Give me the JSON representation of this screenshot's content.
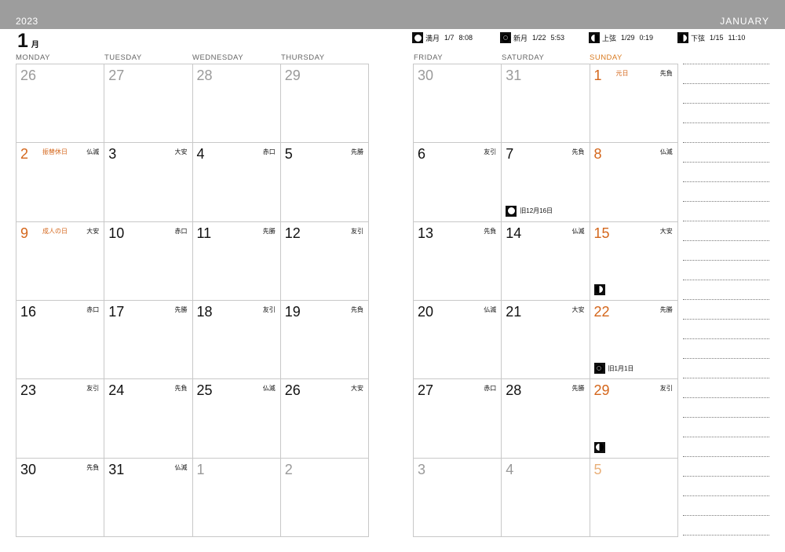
{
  "header": {
    "year": "2023",
    "month_name": "JANUARY",
    "month_number": "1",
    "month_kanji": "月"
  },
  "moon_phases": [
    {
      "icon": "full-moon-icon",
      "label": "満月",
      "date": "1/7",
      "time": "8:08"
    },
    {
      "icon": "new-moon-icon",
      "label": "新月",
      "date": "1/22",
      "time": "5:53"
    },
    {
      "icon": "first-quarter-moon-icon",
      "label": "上弦",
      "date": "1/29",
      "time": "0:19"
    },
    {
      "icon": "last-quarter-moon-icon",
      "label": "下弦",
      "date": "1/15",
      "time": "11:10"
    }
  ],
  "weekdays_left": [
    "MONDAY",
    "TUESDAY",
    "WEDNESDAY",
    "THURSDAY"
  ],
  "weekdays_right": [
    "FRIDAY",
    "SATURDAY",
    "SUNDAY"
  ],
  "weeks": [
    [
      {
        "day": "26",
        "other": true
      },
      {
        "day": "27",
        "other": true
      },
      {
        "day": "28",
        "other": true
      },
      {
        "day": "29",
        "other": true
      },
      {
        "day": "30",
        "other": true
      },
      {
        "day": "31",
        "other": true
      },
      {
        "day": "1",
        "holiday": "元日",
        "rokuyo": "先負"
      }
    ],
    [
      {
        "day": "2",
        "holiday": "振替休日",
        "rokuyo": "仏滅"
      },
      {
        "day": "3",
        "rokuyo": "大安"
      },
      {
        "day": "4",
        "rokuyo": "赤口"
      },
      {
        "day": "5",
        "rokuyo": "先勝"
      },
      {
        "day": "6",
        "rokuyo": "友引"
      },
      {
        "day": "7",
        "rokuyo": "先負",
        "moon": "full",
        "note": "旧12月16日"
      },
      {
        "day": "8",
        "rokuyo": "仏滅"
      }
    ],
    [
      {
        "day": "9",
        "holiday": "成人の日",
        "rokuyo": "大安"
      },
      {
        "day": "10",
        "rokuyo": "赤口"
      },
      {
        "day": "11",
        "rokuyo": "先勝"
      },
      {
        "day": "12",
        "rokuyo": "友引"
      },
      {
        "day": "13",
        "rokuyo": "先負"
      },
      {
        "day": "14",
        "rokuyo": "仏滅"
      },
      {
        "day": "15",
        "rokuyo": "大安",
        "moon": "lq"
      }
    ],
    [
      {
        "day": "16",
        "rokuyo": "赤口"
      },
      {
        "day": "17",
        "rokuyo": "先勝"
      },
      {
        "day": "18",
        "rokuyo": "友引"
      },
      {
        "day": "19",
        "rokuyo": "先負"
      },
      {
        "day": "20",
        "rokuyo": "仏滅"
      },
      {
        "day": "21",
        "rokuyo": "大安"
      },
      {
        "day": "22",
        "rokuyo": "先勝",
        "moon": "new",
        "note": "旧1月1日"
      }
    ],
    [
      {
        "day": "23",
        "rokuyo": "友引"
      },
      {
        "day": "24",
        "rokuyo": "先負"
      },
      {
        "day": "25",
        "rokuyo": "仏滅"
      },
      {
        "day": "26",
        "rokuyo": "大安"
      },
      {
        "day": "27",
        "rokuyo": "赤口"
      },
      {
        "day": "28",
        "rokuyo": "先勝"
      },
      {
        "day": "29",
        "rokuyo": "友引",
        "moon": "fq"
      }
    ],
    [
      {
        "day": "30",
        "rokuyo": "先負"
      },
      {
        "day": "31",
        "rokuyo": "仏滅"
      },
      {
        "day": "1",
        "other": true
      },
      {
        "day": "2",
        "other": true
      },
      {
        "day": "3",
        "other": true
      },
      {
        "day": "4",
        "other": true
      },
      {
        "day": "5",
        "other": true
      }
    ]
  ]
}
